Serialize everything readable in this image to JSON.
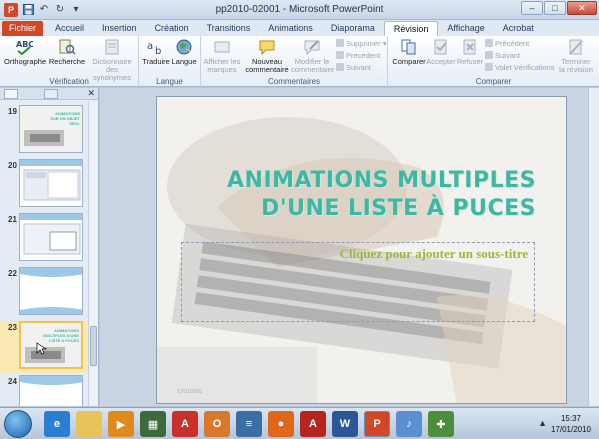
{
  "window": {
    "title": "pp2010-02001  -  Microsoft PowerPoint",
    "qat_icons": [
      "powerpoint-logo-icon",
      "save-icon",
      "undo-icon",
      "redo-icon",
      "customize-icon"
    ],
    "logo_letter": "P",
    "buttons": {
      "minimize": "–",
      "maximize": "□",
      "close": "✕"
    }
  },
  "tabs": [
    {
      "label": "Fichier",
      "kind": "file"
    },
    {
      "label": "Accueil"
    },
    {
      "label": "Insertion"
    },
    {
      "label": "Création"
    },
    {
      "label": "Transitions"
    },
    {
      "label": "Animations"
    },
    {
      "label": "Diaporama"
    },
    {
      "label": "Révision",
      "active": true
    },
    {
      "label": "Affichage"
    },
    {
      "label": "Acrobat"
    }
  ],
  "ribbon": {
    "verification": {
      "label": "Vérification",
      "orthographe": "Orthographe",
      "recherche": "Recherche",
      "dictionnaire_l1": "Dictionnaire",
      "dictionnaire_l2": "des synonymes"
    },
    "langue": {
      "label": "Langue",
      "traduire": "Traduire",
      "langue": "Langue"
    },
    "commentaires": {
      "label": "Commentaires",
      "afficher_l1": "Afficher les",
      "afficher_l2": "marques",
      "nouveau_l1": "Nouveau",
      "nouveau_l2": "commentaire",
      "modifier_l1": "Modifier le",
      "modifier_l2": "commentaire",
      "supprimer": "Supprimer",
      "precedent": "Précédent",
      "suivant": "Suivant"
    },
    "comparer": {
      "label": "Comparer",
      "comparer": "Comparer",
      "accepter": "Accepter",
      "refuser": "Refuser",
      "precedent": "Précédent",
      "suivant": "Suivant",
      "volet": "Volet Vérifications",
      "terminer_l1": "Terminer",
      "terminer_l2": "la révision"
    }
  },
  "slides_pane": {
    "close": "✕",
    "thumbnails": [
      {
        "number": "19",
        "caption": "ANIMATIONS SUR UN OBJET SEUL"
      },
      {
        "number": "20",
        "caption": ""
      },
      {
        "number": "21",
        "caption": ""
      },
      {
        "number": "22",
        "caption": ""
      },
      {
        "number": "23",
        "caption": "ANIMATIONS MULTIPLES D'UNE LISTE A PUCES",
        "selected": true
      },
      {
        "number": "24",
        "caption": ""
      }
    ]
  },
  "slide": {
    "title_line1": "ANIMATIONS MULTIPLES",
    "title_line2": "D'UNE LISTE À PUCES",
    "subtitle_placeholder": "Cliquez pour ajouter un sous-titre",
    "footer": "17/01/2010"
  },
  "taskbar": {
    "apps": [
      {
        "name": "ie-icon",
        "label": "e",
        "color": "#2a7fd4"
      },
      {
        "name": "explorer-icon",
        "label": "",
        "color": "#e7c35a"
      },
      {
        "name": "media-player-icon",
        "label": "▶",
        "color": "#e08a1e"
      },
      {
        "name": "calculator-icon",
        "label": "▦",
        "color": "#3d6a3a"
      },
      {
        "name": "acrobat-icon",
        "label": "A",
        "color": "#c9302c"
      },
      {
        "name": "outlook-icon",
        "label": "O",
        "color": "#d9772b"
      },
      {
        "name": "notepad-icon",
        "label": "≡",
        "color": "#3b6ea5"
      },
      {
        "name": "firefox-icon",
        "label": "●",
        "color": "#e0661b"
      },
      {
        "name": "acrobat-reader-icon",
        "label": "A",
        "color": "#b5261d"
      },
      {
        "name": "word-icon",
        "label": "W",
        "color": "#2b5797"
      },
      {
        "name": "powerpoint-taskbar-icon",
        "label": "P",
        "color": "#d24726",
        "active": true
      },
      {
        "name": "itunes-icon",
        "label": "♪",
        "color": "#5a8fd0"
      },
      {
        "name": "network-app-icon",
        "label": "✚",
        "color": "#4c8e3a"
      }
    ],
    "tray_symbol": "▲",
    "time": "15:37",
    "date": "17/01/2010"
  }
}
